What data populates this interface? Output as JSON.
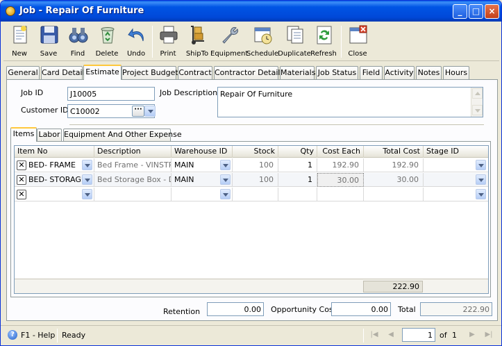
{
  "window": {
    "title": "Job - Repair Of Furniture"
  },
  "toolbar": {
    "items": [
      {
        "label": "New",
        "icon": "new-document-icon"
      },
      {
        "label": "Save",
        "icon": "floppy-disk-icon"
      },
      {
        "label": "Find",
        "icon": "binoculars-icon"
      },
      {
        "label": "Delete",
        "icon": "recycle-bin-icon"
      },
      {
        "label": "Undo",
        "icon": "undo-arrow-icon"
      },
      {
        "label": "Print",
        "icon": "printer-icon"
      },
      {
        "label": "ShipTo",
        "icon": "handtruck-icon"
      },
      {
        "label": "Equipment",
        "icon": "wrench-icon"
      },
      {
        "label": "Schedule",
        "icon": "calendar-icon"
      },
      {
        "label": "Duplicate",
        "icon": "duplicate-icon"
      },
      {
        "label": "Refresh",
        "icon": "refresh-icon"
      },
      {
        "label": "Close",
        "icon": "close-window-icon"
      }
    ]
  },
  "tabs": [
    "General",
    "Card Detail",
    "Estimate",
    "Project Budget",
    "Contract",
    "Contractor Details",
    "Materials",
    "Job Status",
    "Field",
    "Activity",
    "Notes",
    "Hours"
  ],
  "active_tab": "Estimate",
  "header": {
    "job_id_label": "Job ID",
    "job_id": "J10005",
    "customer_id_label": "Customer ID",
    "customer_id": "C10002",
    "job_description_label": "Job Description",
    "job_description": "Repair Of Furniture"
  },
  "subtabs": [
    "Items",
    "Labor",
    "Equipment And Other Expense"
  ],
  "active_subtab": "Items",
  "grid": {
    "columns": [
      "Item No",
      "Description",
      "Warehouse ID",
      "Stock",
      "Qty",
      "Cost Each",
      "Total Cost",
      "Stage ID"
    ],
    "rows": [
      {
        "item_no": "BED- FRAME",
        "description": "Bed Frame - VINSTRA",
        "warehouse": "MAIN",
        "stock": "100",
        "qty": "1",
        "cost_each": "192.90",
        "total_cost": "192.90",
        "stage": ""
      },
      {
        "item_no": "BED- STORAGE",
        "description": "Bed Storage Box - DE",
        "warehouse": "MAIN",
        "stock": "100",
        "qty": "1",
        "cost_each": "30.00",
        "total_cost": "30.00",
        "stage": ""
      }
    ],
    "total_cost_sum": "222.90"
  },
  "footer": {
    "retention_label": "Retention",
    "retention": "0.00",
    "opportunity_cost_label": "Opportunity Cost",
    "opportunity_cost": "0.00",
    "total_label": "Total",
    "total": "222.90"
  },
  "statusbar": {
    "help": "F1 - Help",
    "status": "Ready",
    "page": "1",
    "of_label": "of",
    "page_count": "1"
  }
}
